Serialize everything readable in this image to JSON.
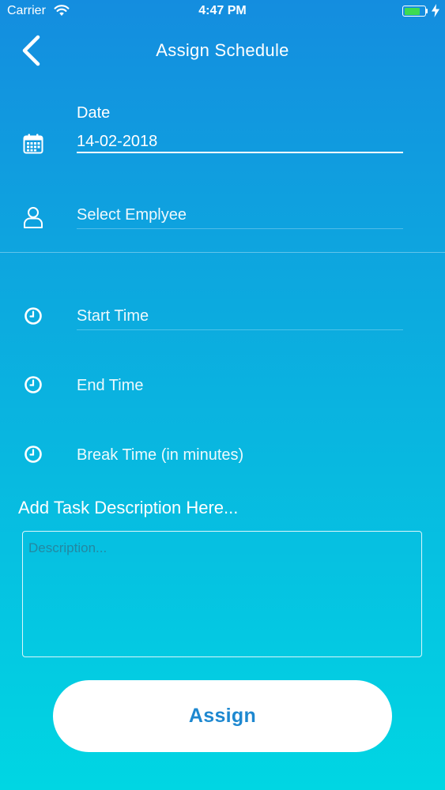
{
  "status_bar": {
    "carrier": "Carrier",
    "time": "4:47 PM",
    "battery_fill_fraction": 0.8,
    "battery_color": "#3ddb52"
  },
  "header": {
    "title": "Assign Schedule",
    "back_icon": "chevron-left-icon"
  },
  "form": {
    "date": {
      "label": "Date",
      "value": "14-02-2018",
      "icon": "calendar-icon"
    },
    "employee": {
      "placeholder": "Select Emplyee",
      "icon": "person-icon"
    },
    "start_time": {
      "placeholder": "Start Time",
      "icon": "clock-icon"
    },
    "end_time": {
      "placeholder": "End Time",
      "icon": "clock-icon"
    },
    "break_time": {
      "placeholder": "Break Time (in minutes)",
      "icon": "clock-icon"
    },
    "task_section_title": "Add Task Description Here...",
    "description_placeholder": "Description..."
  },
  "actions": {
    "assign_label": "Assign"
  },
  "colors": {
    "gradient_top": "#148ddf",
    "gradient_bottom": "#00d6e3",
    "button_text": "#1e88d0"
  }
}
